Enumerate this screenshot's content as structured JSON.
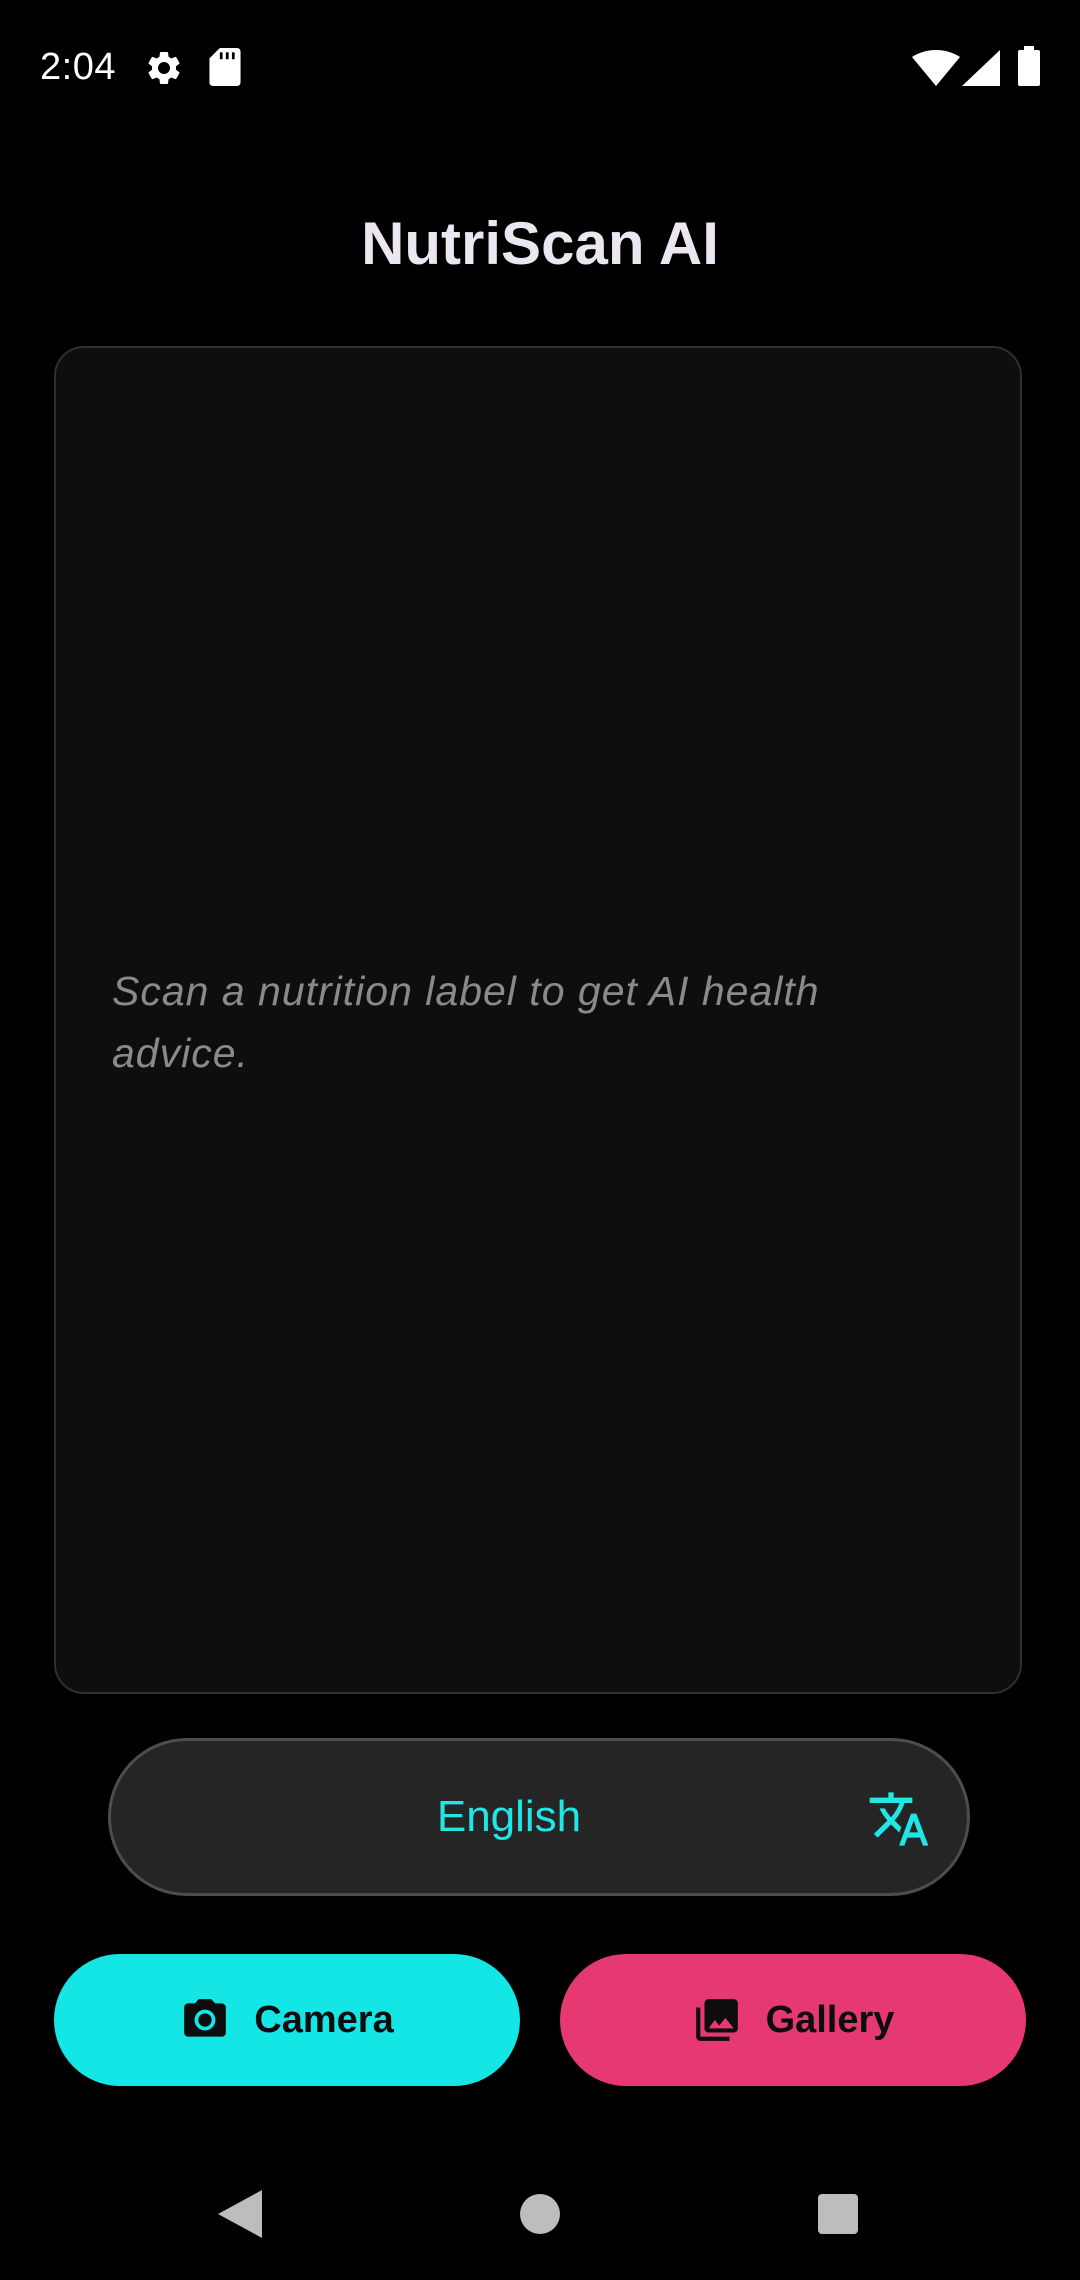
{
  "status_bar": {
    "time": "2:04",
    "icons": [
      "settings-icon",
      "sd-card-icon",
      "wifi-icon",
      "cell-signal-icon",
      "battery-icon"
    ]
  },
  "app": {
    "title": "NutriScan AI"
  },
  "result_card": {
    "placeholder": "Scan a nutrition label to get AI health advice."
  },
  "language": {
    "selected": "English",
    "icon": "translate-icon"
  },
  "actions": {
    "camera_label": "Camera",
    "gallery_label": "Gallery",
    "camera_icon": "camera-icon",
    "gallery_icon": "photo-library-icon"
  },
  "nav_bar": {
    "icons": [
      "back-icon",
      "home-icon",
      "recents-icon"
    ]
  },
  "colors": {
    "background": "#000000",
    "accent_cyan": "#14e6e6",
    "accent_pink": "#e63972",
    "card": "#0e0e0e",
    "selector": "#252525"
  }
}
